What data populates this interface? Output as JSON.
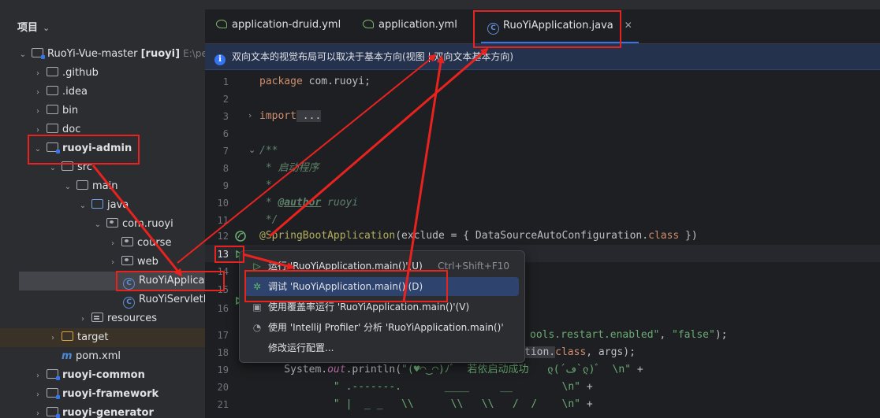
{
  "project": {
    "header": "项目",
    "tree": [
      {
        "label": "RuoYi-Vue-master",
        "extra": "[ruoyi]",
        "path": "E:\\pers"
      },
      {
        "label": ".github"
      },
      {
        "label": ".idea"
      },
      {
        "label": "bin"
      },
      {
        "label": "doc"
      },
      {
        "label": "ruoyi-admin"
      },
      {
        "label": "src"
      },
      {
        "label": "main"
      },
      {
        "label": "java"
      },
      {
        "label": "com.ruoyi"
      },
      {
        "label": "course"
      },
      {
        "label": "web"
      },
      {
        "label": "RuoYiApplicati"
      },
      {
        "label": "RuoYiServletIn"
      },
      {
        "label": "resources"
      },
      {
        "label": "target"
      },
      {
        "label": "pom.xml"
      },
      {
        "label": "ruoyi-common"
      },
      {
        "label": "ruoyi-framework"
      },
      {
        "label": "ruoyi-generator"
      }
    ]
  },
  "tabs": [
    {
      "label": "application-druid.yml"
    },
    {
      "label": "application.yml"
    },
    {
      "label": "RuoYiApplication.java",
      "active": true
    }
  ],
  "banner": {
    "text": "双向文本的视觉布局可以取决于基本方向(视图 | 双向文本基本方向)"
  },
  "editor": {
    "line_numbers": [
      "1",
      "2",
      "3",
      "6",
      "7",
      "8",
      "9",
      "10",
      "11",
      "12",
      "13",
      "14",
      "15",
      "16",
      "17",
      "18",
      "19",
      "20",
      "21"
    ],
    "code": {
      "l1_kw": "package",
      "l1_rest": " com.ruoyi;",
      "l3_kw": "import",
      "l3_rest": " ...",
      "l7": "/**",
      "l8": " * 启动程序",
      "l9": " *",
      "l10_a": " * ",
      "l10_tag": "@author",
      "l10_b": " ruoyi",
      "l11": " */",
      "l12_ann": "@SpringBootApplication",
      "l12_rest": "(exclude = { DataSourceAutoConfiguration.",
      "l12_kw": "class",
      "l12_end": " })",
      "l17_str": "ools.restart.enabled\"",
      "l17_mid": ", ",
      "l17_str2": "\"false\"",
      "l17_end": ");",
      "l18_a": "tion.",
      "l18_kw": "class",
      "l18_b": ", args);",
      "l19_a": "    System.",
      "l19_fld": "out",
      "l19_b": ".println(",
      "l19_str": "\"(♥◠‿◠)ﾉﾞ  若依启动成功   ლ(´ڡ`ლ)ﾞ  \\n\"",
      "l19_c": " +",
      "l20_str": "            \" .-------.       ____     __        \\n\"",
      "l20_c": " +",
      "l21_str": "            \" |  _ _   \\\\      \\\\   \\\\   /  /    \\n\"",
      "l21_c": " +"
    }
  },
  "popup": {
    "items": [
      {
        "label": "运行 'RuoYiApplication.main()'(U)",
        "shortcut": "Ctrl+Shift+F10"
      },
      {
        "label": "调试 'RuoYiApplication.main()'(D)"
      },
      {
        "label": "使用覆盖率运行 'RuoYiApplication.main()'(V)"
      },
      {
        "label": "使用 'IntelliJ Profiler' 分析  'RuoYiApplication.main()'"
      },
      {
        "label": "修改运行配置..."
      }
    ]
  },
  "colors": {
    "annotation_red": "#e8231f",
    "accent": "#3574f0"
  }
}
